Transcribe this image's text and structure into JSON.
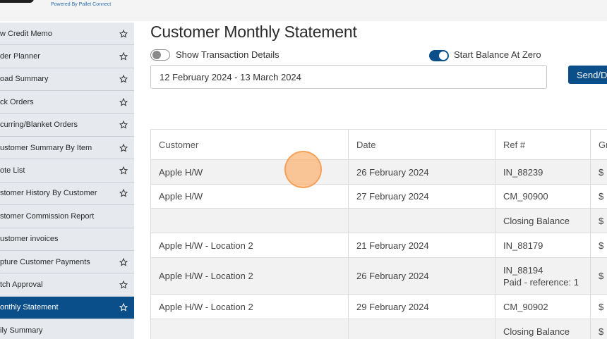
{
  "header": {
    "powered_by": "Powered By Pallet Connect"
  },
  "sidebar": {
    "items": [
      {
        "label": "w Credit Memo",
        "star": true,
        "active": false
      },
      {
        "label": "der Planner",
        "star": true,
        "active": false
      },
      {
        "label": "oad Summary",
        "star": true,
        "active": false
      },
      {
        "label": "ck Orders",
        "star": true,
        "active": false
      },
      {
        "label": "curring/Blanket Orders",
        "star": true,
        "active": false
      },
      {
        "label": "ustomer Summary By Item",
        "star": true,
        "active": false
      },
      {
        "label": "ote List",
        "star": true,
        "active": false
      },
      {
        "label": "stomer History By Customer",
        "star": true,
        "active": false
      },
      {
        "label": "stomer Commission Report",
        "star": false,
        "active": false
      },
      {
        "label": "ustomer invoices",
        "star": false,
        "active": false
      },
      {
        "label": "pture Customer Payments",
        "star": true,
        "active": false
      },
      {
        "label": "tch Approval",
        "star": true,
        "active": false
      },
      {
        "label": "onthly Statement",
        "star": true,
        "active": true
      },
      {
        "label": "ily Summary",
        "star": false,
        "active": false
      }
    ]
  },
  "main": {
    "title": "Customer Monthly Statement",
    "show_transaction_details": {
      "label": "Show Transaction Details",
      "on": false
    },
    "start_balance_at_zero": {
      "label": "Start Balance At Zero",
      "on": true
    },
    "date_range": "12 February 2024 - 13 March 2024",
    "send_button": "Send/D"
  },
  "table": {
    "headers": [
      "Customer",
      "Date",
      "Ref #",
      "Gr"
    ],
    "rows": [
      {
        "customer": "Apple H/W",
        "date": "26 February 2024",
        "ref": "IN_88239",
        "ref_sub": "",
        "amount": "$"
      },
      {
        "customer": "Apple H/W",
        "date": "27 February 2024",
        "ref": "CM_90900",
        "ref_sub": "",
        "amount": "$"
      },
      {
        "customer": "",
        "date": "",
        "ref": "Closing Balance",
        "ref_sub": "",
        "amount": "$"
      },
      {
        "customer": "Apple H/W - Location 2",
        "date": "21 February 2024",
        "ref": "IN_88179",
        "ref_sub": "",
        "amount": "$"
      },
      {
        "customer": "Apple H/W - Location 2",
        "date": "26 February 2024",
        "ref": "IN_88194",
        "ref_sub": "Paid - reference: 1",
        "amount": "$"
      },
      {
        "customer": "Apple H/W - Location 2",
        "date": "29 February 2024",
        "ref": "CM_90902",
        "ref_sub": "",
        "amount": "$"
      },
      {
        "customer": "",
        "date": "",
        "ref": "Closing Balance",
        "ref_sub": "",
        "amount": "$"
      }
    ]
  },
  "colors": {
    "accent": "#0b4f8a",
    "sidebar_bg": "#e6e9ee",
    "cursor": "#fcaa64"
  },
  "icons": {
    "star": "star-outline-icon"
  }
}
